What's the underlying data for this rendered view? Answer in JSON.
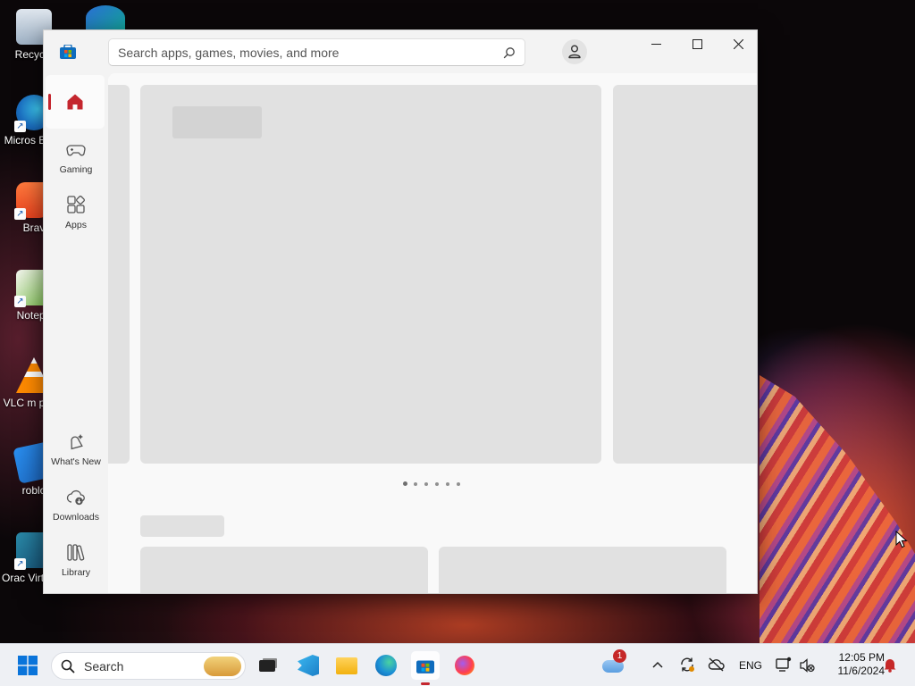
{
  "desktop": {
    "icons": [
      {
        "name": "recycle-bin",
        "label": "Recycle"
      },
      {
        "name": "microsoft-edge",
        "label": "Micros Edge"
      },
      {
        "name": "brave",
        "label": "Brav"
      },
      {
        "name": "notepad",
        "label": "Notepa"
      },
      {
        "name": "vlc",
        "label": "VLC m playe"
      },
      {
        "name": "roblox",
        "label": "roblo"
      },
      {
        "name": "virtualbox",
        "label": "Orac VirtualBox"
      }
    ]
  },
  "window": {
    "search": {
      "placeholder": "Search apps, games, movies, and more"
    },
    "nav": {
      "home": "",
      "gaming": "Gaming",
      "apps": "Apps",
      "whats_new": "What's New",
      "downloads": "Downloads",
      "library": "Library"
    },
    "carousel": {
      "page_count": 6,
      "active_index": 0
    }
  },
  "taskbar": {
    "search_label": "Search",
    "language": "ENG",
    "time": "12:05 PM",
    "date": "11/6/2024",
    "weather_badge": "1"
  },
  "colors": {
    "accent": "#c4262e",
    "placeholder": "#e1e1e1",
    "placeholder_dark": "#d3d3d3",
    "window_bg": "#f3f3f3",
    "taskbar_bg": "#eef0f4"
  }
}
